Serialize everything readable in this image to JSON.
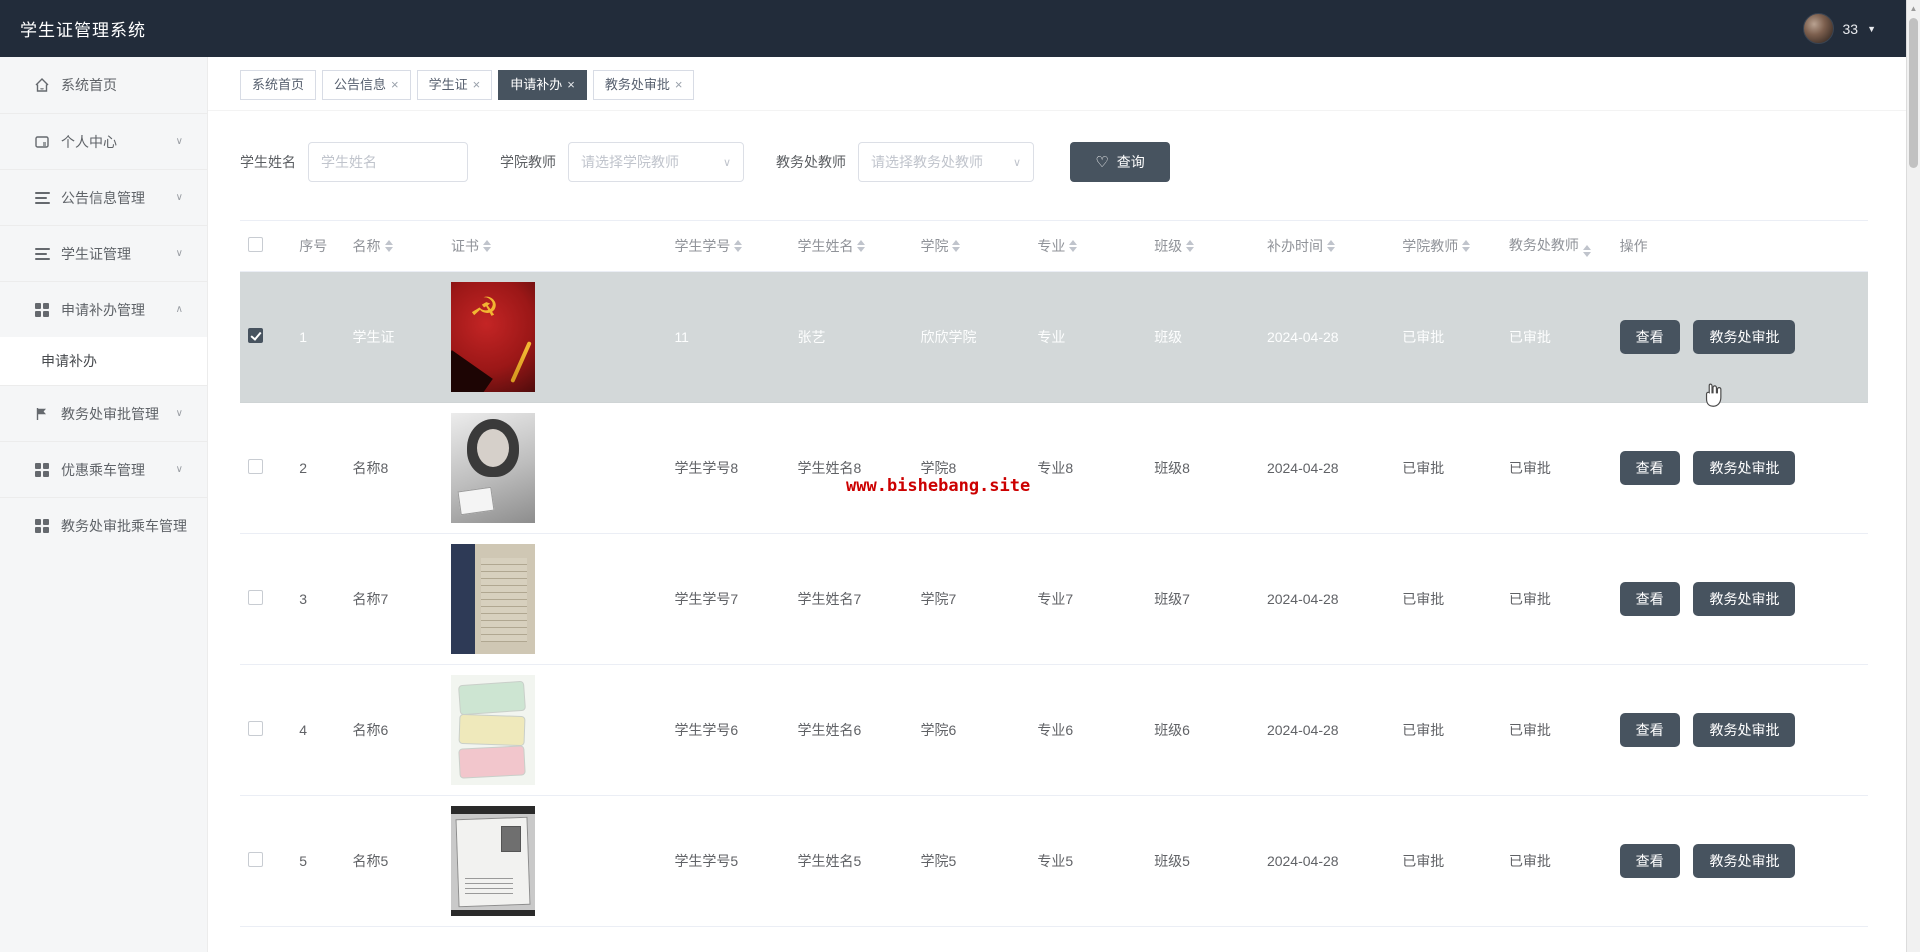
{
  "app": {
    "title": "学生证管理系统",
    "user": {
      "name": "33"
    }
  },
  "icons": {
    "close": "×",
    "caret_down": "∨",
    "caret_up": "∧",
    "user_caret": "▼",
    "heart": "♡",
    "select_caret": "∨",
    "scroll_up_arrow": "▲",
    "party_emblem": "☭"
  },
  "tabs": [
    {
      "label": "系统首页",
      "closable": false,
      "active": false
    },
    {
      "label": "公告信息",
      "closable": true,
      "active": false
    },
    {
      "label": "学生证",
      "closable": true,
      "active": false
    },
    {
      "label": "申请补办",
      "closable": true,
      "active": true
    },
    {
      "label": "教务处审批",
      "closable": true,
      "active": false
    }
  ],
  "sidebar": {
    "items": [
      {
        "label": "系统首页",
        "icon": "home-icon",
        "expandable": false
      },
      {
        "label": "个人中心",
        "icon": "panel-icon",
        "expandable": true
      },
      {
        "label": "公告信息管理",
        "icon": "list-icon",
        "expandable": true
      },
      {
        "label": "学生证管理",
        "icon": "list-icon",
        "expandable": true
      },
      {
        "label": "申请补办管理",
        "icon": "grid-icon",
        "expandable": true,
        "expanded": true,
        "children": [
          {
            "label": "申请补办",
            "active": true
          }
        ]
      },
      {
        "label": "教务处审批管理",
        "icon": "flag-icon",
        "expandable": true
      },
      {
        "label": "优惠乘车管理",
        "icon": "grid-icon",
        "expandable": true
      },
      {
        "label": "教务处审批乘车管理",
        "icon": "grid-icon",
        "expandable": false
      }
    ]
  },
  "search": {
    "student_name_label": "学生姓名",
    "student_name_placeholder": "学生姓名",
    "student_name_value": "",
    "college_teacher_label": "学院教师",
    "college_teacher_placeholder": "请选择学院教师",
    "office_teacher_label": "教务处教师",
    "office_teacher_placeholder": "请选择教务处教师",
    "query_label": "查询"
  },
  "table": {
    "columns": [
      "序号",
      "名称",
      "证书",
      "学生学号",
      "学生姓名",
      "学院",
      "专业",
      "班级",
      "补办时间",
      "学院教师",
      "教务处教师",
      "操作"
    ],
    "actions": {
      "view": "查看",
      "approve": "教务处审批"
    },
    "rows": [
      {
        "index": "1",
        "name": "学生证",
        "cert_image": "red-party-book-photo",
        "student_no": "11",
        "student_name": "张艺",
        "college": "欣欣学院",
        "major": "专业",
        "class": "班级",
        "date": "2024-04-28",
        "college_teacher": "已审批",
        "office_teacher": "已审批",
        "selected": true
      },
      {
        "index": "2",
        "name": "名称8",
        "cert_image": "bw-girl-holding-card-photo",
        "student_no": "学生学号8",
        "student_name": "学生姓名8",
        "college": "学院8",
        "major": "专业8",
        "class": "班级8",
        "date": "2024-04-28",
        "college_teacher": "已审批",
        "office_teacher": "已审批",
        "selected": false
      },
      {
        "index": "3",
        "name": "名称7",
        "cert_image": "old-booklet-photo",
        "student_no": "学生学号7",
        "student_name": "学生姓名7",
        "college": "学院7",
        "major": "专业7",
        "class": "班级7",
        "date": "2024-04-28",
        "college_teacher": "已审批",
        "office_teacher": "已审批",
        "selected": false
      },
      {
        "index": "4",
        "name": "名称6",
        "cert_image": "pastel-student-cards-photo",
        "student_no": "学生学号6",
        "student_name": "学生姓名6",
        "college": "学院6",
        "major": "专业6",
        "class": "班级6",
        "date": "2024-04-28",
        "college_teacher": "已审批",
        "office_teacher": "已审批",
        "selected": false
      },
      {
        "index": "5",
        "name": "名称5",
        "cert_image": "bw-student-id-document-photo",
        "student_no": "学生学号5",
        "student_name": "学生姓名5",
        "college": "学院5",
        "major": "专业5",
        "class": "班级5",
        "date": "2024-04-28",
        "college_teacher": "已审批",
        "office_teacher": "已审批",
        "selected": false
      }
    ]
  },
  "watermark": {
    "text": "www.bishebang.site"
  },
  "colors": {
    "header_bg": "#222c3a",
    "accent_dark": "#47535f",
    "selected_row_bg": "#d3d8d9",
    "watermark_red": "#cc0000",
    "sidebar_bg": "#f5f6f7",
    "border": "#ebeef5",
    "muted_text": "#909399"
  }
}
